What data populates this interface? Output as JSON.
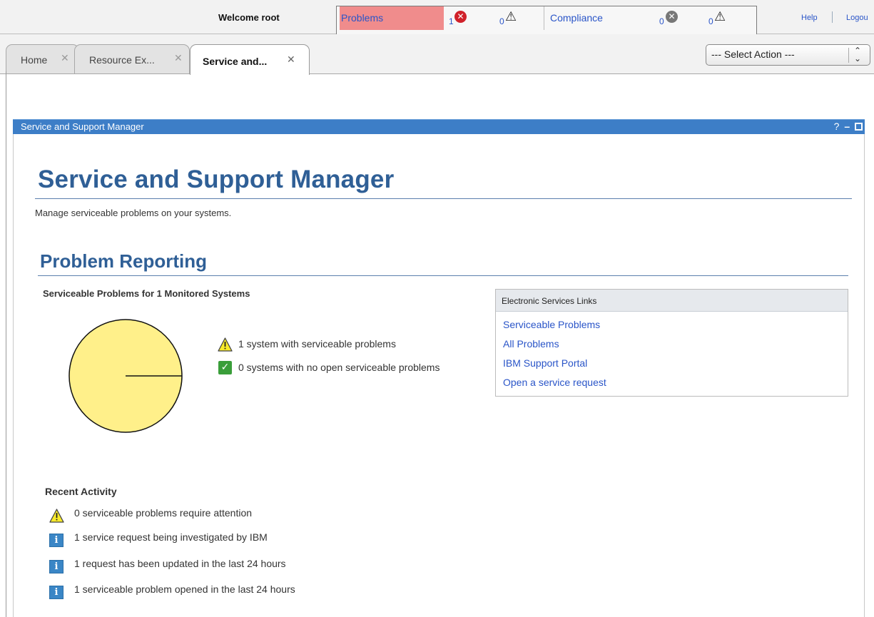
{
  "header": {
    "welcome": "Welcome root",
    "problems_label": "Problems",
    "problems_error_count": "1",
    "problems_warning_count": "0",
    "compliance_label": "Compliance",
    "compliance_error_count": "0",
    "compliance_warning_count": "0",
    "help_label": "Help",
    "logout_label": "Logou"
  },
  "tabs": [
    {
      "label": "Home",
      "active": false
    },
    {
      "label": "Resource Ex...",
      "active": false
    },
    {
      "label": "Service and...",
      "active": true
    }
  ],
  "select_action": {
    "value": "--- Select Action ---"
  },
  "portlet": {
    "title": "Service and Support Manager",
    "controls": {
      "help": "?"
    }
  },
  "page": {
    "title": "Service and Support Manager",
    "description": "Manage serviceable problems on your systems."
  },
  "problem_reporting": {
    "title": "Problem Reporting",
    "chart_title": "Serviceable Problems for 1 Monitored Systems",
    "legend": [
      {
        "icon": "warning-icon",
        "text": "1 system with serviceable problems"
      },
      {
        "icon": "check-icon",
        "text": "0 systems with no open serviceable problems"
      }
    ]
  },
  "chart_data": {
    "type": "pie",
    "title": "Serviceable Problems for 1 Monitored Systems",
    "categories": [
      "1 system with serviceable problems",
      "0 systems with no open serviceable problems"
    ],
    "values": [
      1,
      0
    ],
    "colors": [
      "#fff08a",
      "#3a9e3a"
    ]
  },
  "links": {
    "title": "Electronic Services Links",
    "items": [
      "Serviceable Problems",
      "All Problems",
      "IBM Support Portal",
      "Open a service request"
    ]
  },
  "recent_activity": {
    "title": "Recent Activity",
    "items": [
      {
        "icon": "warning-icon",
        "text": "0 serviceable problems require attention"
      },
      {
        "icon": "info-icon",
        "text": "1 service request being investigated by IBM"
      },
      {
        "icon": "info-icon",
        "text": "1 request has been updated in the last 24 hours"
      },
      {
        "icon": "info-icon",
        "text": "1 serviceable problem opened in the last 24 hours"
      }
    ]
  },
  "colors": {
    "accent": "#2f5f96",
    "portlet_bar": "#3d7ec7",
    "problems_highlight": "#f08c8c",
    "link": "#2a55c8"
  }
}
